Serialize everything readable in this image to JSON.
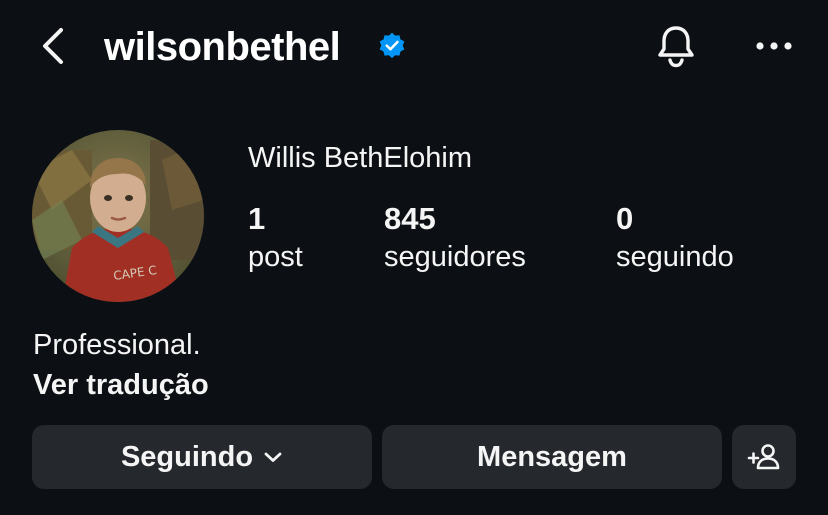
{
  "header": {
    "username": "wilsonbethel",
    "verified_icon": "verified-badge-icon",
    "back_icon": "chevron-left-icon",
    "bell_icon": "bell-icon",
    "more_icon": "more-horizontal-icon"
  },
  "profile": {
    "display_name": "Willis BethElohim",
    "stats": [
      {
        "value": "1",
        "label": "post"
      },
      {
        "value": "845",
        "label": "seguidores"
      },
      {
        "value": "0",
        "label": "seguindo"
      }
    ],
    "bio": "Professional.",
    "translate_label": "Ver tradução"
  },
  "actions": {
    "following_label": "Seguindo",
    "message_label": "Mensagem",
    "add_user_icon": "add-user-icon"
  },
  "colors": {
    "background": "#0c1014",
    "button": "#25292e",
    "verified": "#0095f6",
    "text": "#f5f5f5"
  }
}
